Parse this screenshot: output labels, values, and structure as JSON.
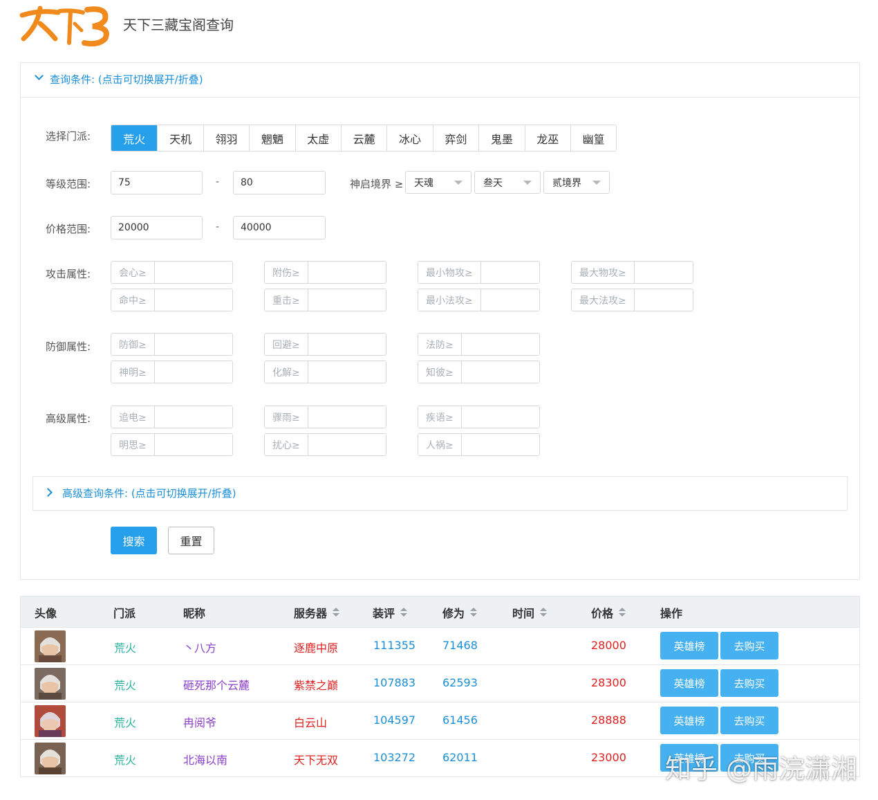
{
  "header": {
    "logo_text": "天下3",
    "title": "天下三藏宝阁查询"
  },
  "query": {
    "title": "查询条件:  (点击可切换展开/折叠)",
    "sect_label": "选择门派:",
    "sects": [
      "荒火",
      "天机",
      "翎羽",
      "魍魉",
      "太虚",
      "云麓",
      "冰心",
      "弈剑",
      "鬼墨",
      "龙巫",
      "幽篁"
    ],
    "selected_sect": "荒火",
    "level_label": "等级范围:",
    "level_min": "75",
    "level_max": "80",
    "range_dash": "-",
    "realm_label": "神启境界 ≥",
    "realm_selects": [
      "天魂",
      "叁天",
      "贰境界"
    ],
    "price_label": "价格范围:",
    "price_min": "20000",
    "price_max": "40000",
    "attack_label": "攻击属性:",
    "attack_fields": [
      "会心≥",
      "附伤≥",
      "最小物攻≥",
      "最大物攻≥",
      "命中≥",
      "重击≥",
      "最小法攻≥",
      "最大法攻≥"
    ],
    "defense_label": "防御属性:",
    "defense_fields": [
      "防御≥",
      "回避≥",
      "法防≥",
      "神明≥",
      "化解≥",
      "知彼≥"
    ],
    "advanced_label": "高级属性:",
    "advanced_fields": [
      "追电≥",
      "骤雨≥",
      "疾语≥",
      "明思≥",
      "扰心≥",
      "人祸≥"
    ],
    "advanced_panel_title": "高级查询条件:  (点击可切换展开/折叠)",
    "search_label": "搜索",
    "reset_label": "重置"
  },
  "table": {
    "headers": [
      "头像",
      "门派",
      "昵称",
      "服务器",
      "装评",
      "修为",
      "时间",
      "价格",
      "操作"
    ],
    "rows": [
      {
        "sect": "荒火",
        "nickname": "丶八方",
        "server": "逐鹿中原",
        "score": "111355",
        "cultivation": "71468",
        "time": "",
        "price": "28000"
      },
      {
        "sect": "荒火",
        "nickname": "砸死那个云麓",
        "server": "紫禁之巅",
        "score": "107883",
        "cultivation": "62593",
        "time": "",
        "price": "28300"
      },
      {
        "sect": "荒火",
        "nickname": "冉阅爷",
        "server": "白云山",
        "score": "104597",
        "cultivation": "61456",
        "time": "",
        "price": "28888"
      },
      {
        "sect": "荒火",
        "nickname": "北海以南",
        "server": "天下无双",
        "score": "103272",
        "cultivation": "62011",
        "time": "",
        "price": "23000"
      }
    ],
    "hero_label": "英雄榜",
    "buy_label": "去购买"
  },
  "watermark": "知乎 @雨浣潇湘",
  "colors": {
    "accent": "#26a0ea",
    "link": "#1a8fd8",
    "sect": "#2ab0a0",
    "nickname": "#8a3fc9",
    "price": "#e02020"
  }
}
